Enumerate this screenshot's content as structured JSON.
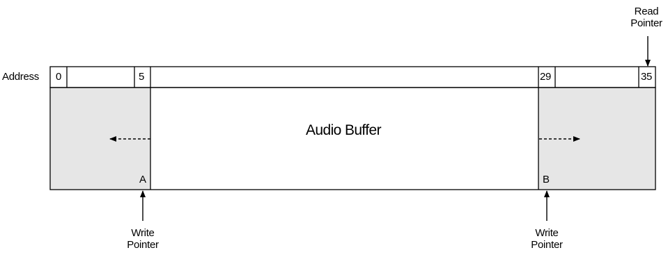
{
  "row_label": "Address",
  "addresses": [
    "0",
    "5",
    "29",
    "35"
  ],
  "buffer_label": "Audio Buffer",
  "regions": [
    "A",
    "B"
  ],
  "read_pointer": {
    "line1": "Read",
    "line2": "Pointer"
  },
  "write_pointers": [
    {
      "line1": "Write",
      "line2": "Pointer"
    },
    {
      "line1": "Write",
      "line2": "Pointer"
    }
  ],
  "colors": {
    "region_fill": "#e6e6e6",
    "stroke": "#000000",
    "background": "#ffffff"
  }
}
